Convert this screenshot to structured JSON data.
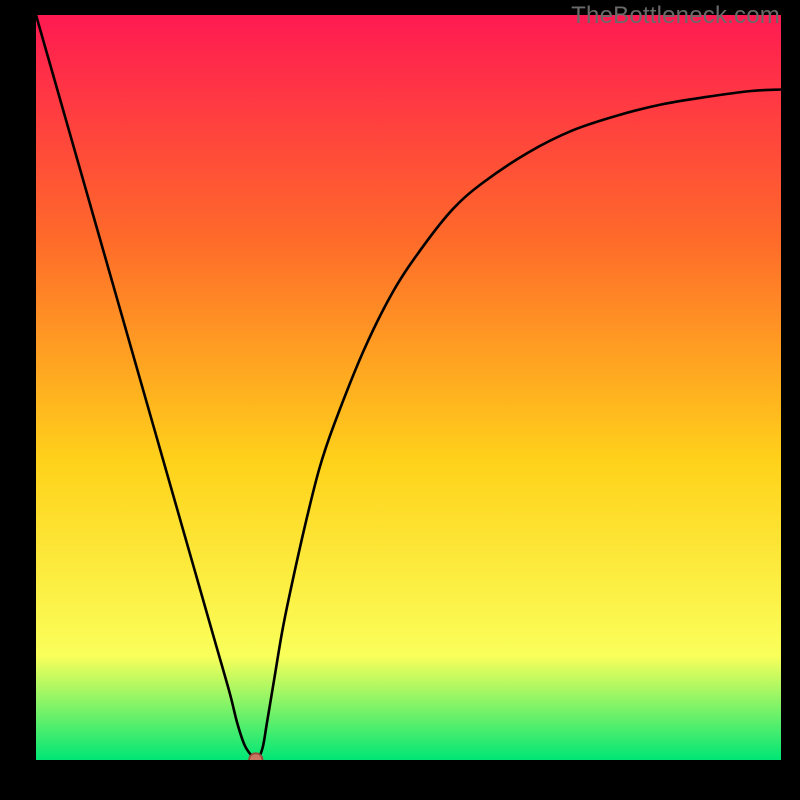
{
  "watermark": "TheBottleneck.com",
  "colors": {
    "bg": "#000000",
    "grad_top": "#ff1a52",
    "grad_midA": "#ff6a2a",
    "grad_midB": "#ffd21a",
    "grad_midC": "#faff5a",
    "grad_bottom": "#00e676",
    "curve": "#000000",
    "marker_fill": "#c97763",
    "marker_stroke": "#9a4c3c"
  },
  "chart_data": {
    "type": "line",
    "title": "",
    "xlabel": "",
    "ylabel": "",
    "xlim": [
      0,
      100
    ],
    "ylim": [
      0,
      100
    ],
    "x": [
      0,
      2,
      4,
      6,
      8,
      10,
      12,
      14,
      16,
      18,
      20,
      22,
      24,
      26,
      27,
      28,
      29,
      29.5,
      30,
      30.5,
      31,
      32,
      33,
      34,
      36,
      38,
      40,
      44,
      48,
      52,
      56,
      60,
      66,
      72,
      78,
      84,
      90,
      96,
      100
    ],
    "values": [
      100,
      93,
      86,
      79,
      72,
      65,
      58,
      51,
      44,
      37,
      30,
      23,
      16,
      9,
      5,
      2,
      0.5,
      0,
      0.5,
      2,
      5,
      11,
      17,
      22,
      31,
      39,
      45,
      55,
      63,
      69,
      74,
      77.5,
      81.5,
      84.5,
      86.5,
      88,
      89,
      89.8,
      90
    ],
    "marker": {
      "x": 29.5,
      "y": 0
    },
    "grid": false,
    "legend": false
  }
}
